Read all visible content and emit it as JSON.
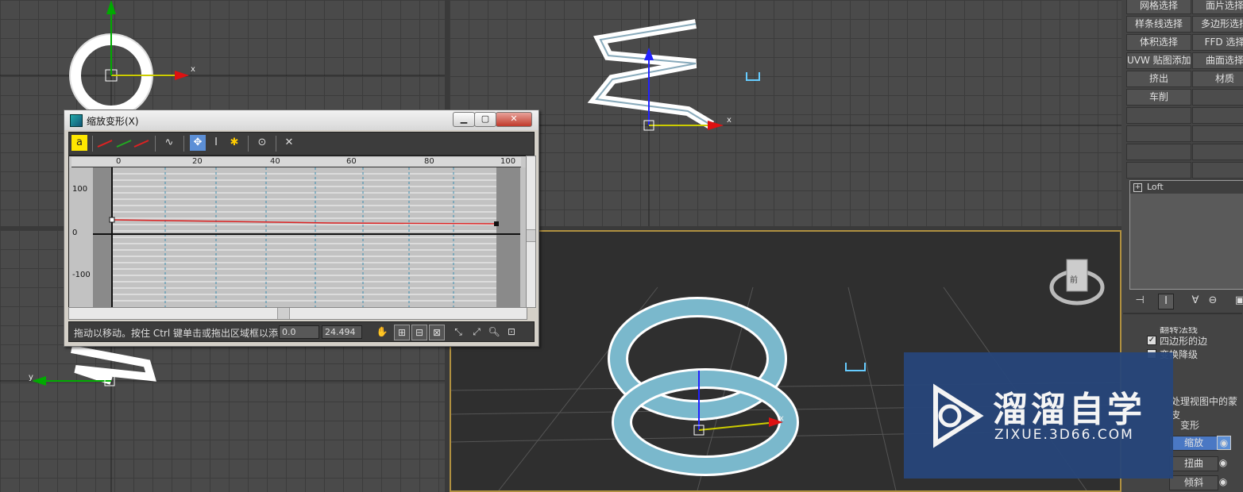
{
  "viewports": {
    "top_axis_x": "x",
    "front_axis_x": "x",
    "left_axis_y": "y",
    "persp_axis_x": "x",
    "viewcube_face": "前"
  },
  "modifier_buttons": [
    {
      "left": "网格选择",
      "right": "面片选择"
    },
    {
      "left": "样条线选择",
      "right": "多边形选择"
    },
    {
      "left": "体积选择",
      "right": "FFD 选择"
    },
    {
      "left": "UVW 贴图添加",
      "right": "曲面选择"
    },
    {
      "left": "挤出",
      "right": "材质"
    },
    {
      "left": "车削",
      "right": ""
    }
  ],
  "modifier_stack": {
    "item": "Loft"
  },
  "stack_tools": [
    "⊣",
    "I",
    "∀",
    "⊖",
    "▣"
  ],
  "panel_options": {
    "partial_top": "翻转法线",
    "quad_sides": "四边形的边",
    "quad_checked": true,
    "transform_degrade": "变换降级",
    "skin_label": "处理视图中的蒙皮",
    "deformations_title": "变形",
    "scale": "缩放",
    "twist": "扭曲",
    "teeter": "倾斜"
  },
  "dialog": {
    "title": "缩放变形(X)",
    "min": "▁",
    "max": "▢",
    "close": "✕",
    "toolbar": {
      "lock": "a",
      "move": "✥",
      "scale_v": "Ⅰ",
      "insert": "✱",
      "hand": "⊙",
      "delete": "✕"
    },
    "ruler": [
      "0",
      "20",
      "40",
      "60",
      "80",
      "100"
    ],
    "y_labels": [
      "100",
      "0",
      "-100"
    ],
    "status": "拖动以移动。按住 Ctrl 键单击或拖出区域框以添",
    "field1": "0.0",
    "field2": "24.494"
  },
  "watermark": {
    "cn": "溜溜自学",
    "en": "ZIXUE.3D66.COM"
  },
  "colors": {
    "accent_blue": "#5c8fd6",
    "lock_yellow": "#ffe800",
    "curve_red": "#d22",
    "wm_bg": "#27467a"
  }
}
